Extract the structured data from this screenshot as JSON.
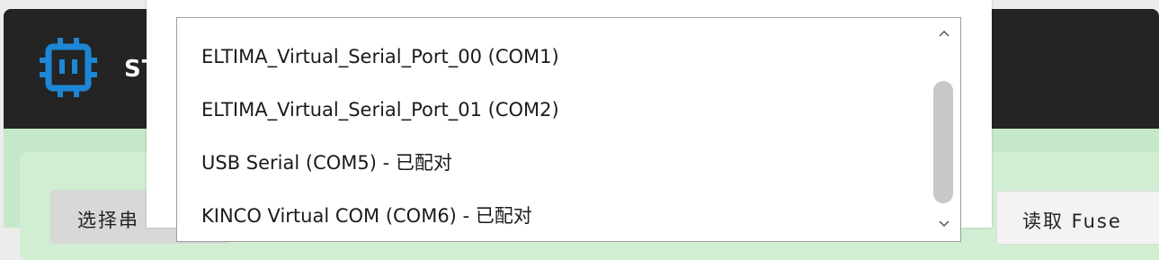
{
  "app": {
    "title": "ST",
    "select_port_label": "选择串",
    "read_fuse_label": "读取 Fuse"
  },
  "port_dropdown": {
    "options": [
      "ELTIMA_Virtual_Serial_Port_00 (COM1)",
      "ELTIMA_Virtual_Serial_Port_01 (COM2)",
      "USB Serial (COM5) - 已配对",
      "KINCO Virtual COM (COM6) - 已配对"
    ],
    "scroll_up_icon": "chevron-up",
    "scroll_down_icon": "chevron-down"
  },
  "colors": {
    "header_bg": "#242424",
    "body_bg": "#c4e8c8",
    "logo_accent": "#1d87d6",
    "popup_bg": "#ffffff"
  }
}
